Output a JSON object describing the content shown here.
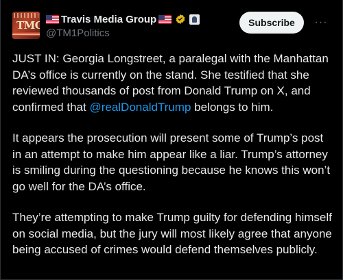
{
  "account": {
    "display_name": "Travis Media Group",
    "handle": "@TM1Politics",
    "avatar_text": "TMG"
  },
  "actions": {
    "subscribe_label": "Subscribe",
    "more_label": "···"
  },
  "post": {
    "p1_text": "JUST IN:  Georgia Longstreet, a paralegal with the Manhattan DA’s office is currently on the stand.  She testified that she reviewed thousands of post from Donald Trump on X, and confirmed that ",
    "p1_mention": "@realDonaldTrump",
    "p1_after": " belongs to him.",
    "p2": "It appears the prosecution will present some of Trump’s post in an attempt to make him appear like a liar.  Trump’s attorney is smiling during the questioning because he knows this won’t go well for the DA’s office.",
    "p3": "They’re attempting to make Trump guilty for defending himself on social media, but the jury will most likely agree that anyone being accused of crimes would defend themselves publicly."
  },
  "colors": {
    "background": "#000000",
    "text": "#e7e9ea",
    "muted": "#71767b",
    "link": "#1d9bf0",
    "button_bg": "#eff3f4",
    "verified_gold": "#e2b719"
  },
  "icons": [
    "us-flag-icon",
    "verified-badge-icon",
    "affiliate-badge-icon",
    "more-icon"
  ]
}
